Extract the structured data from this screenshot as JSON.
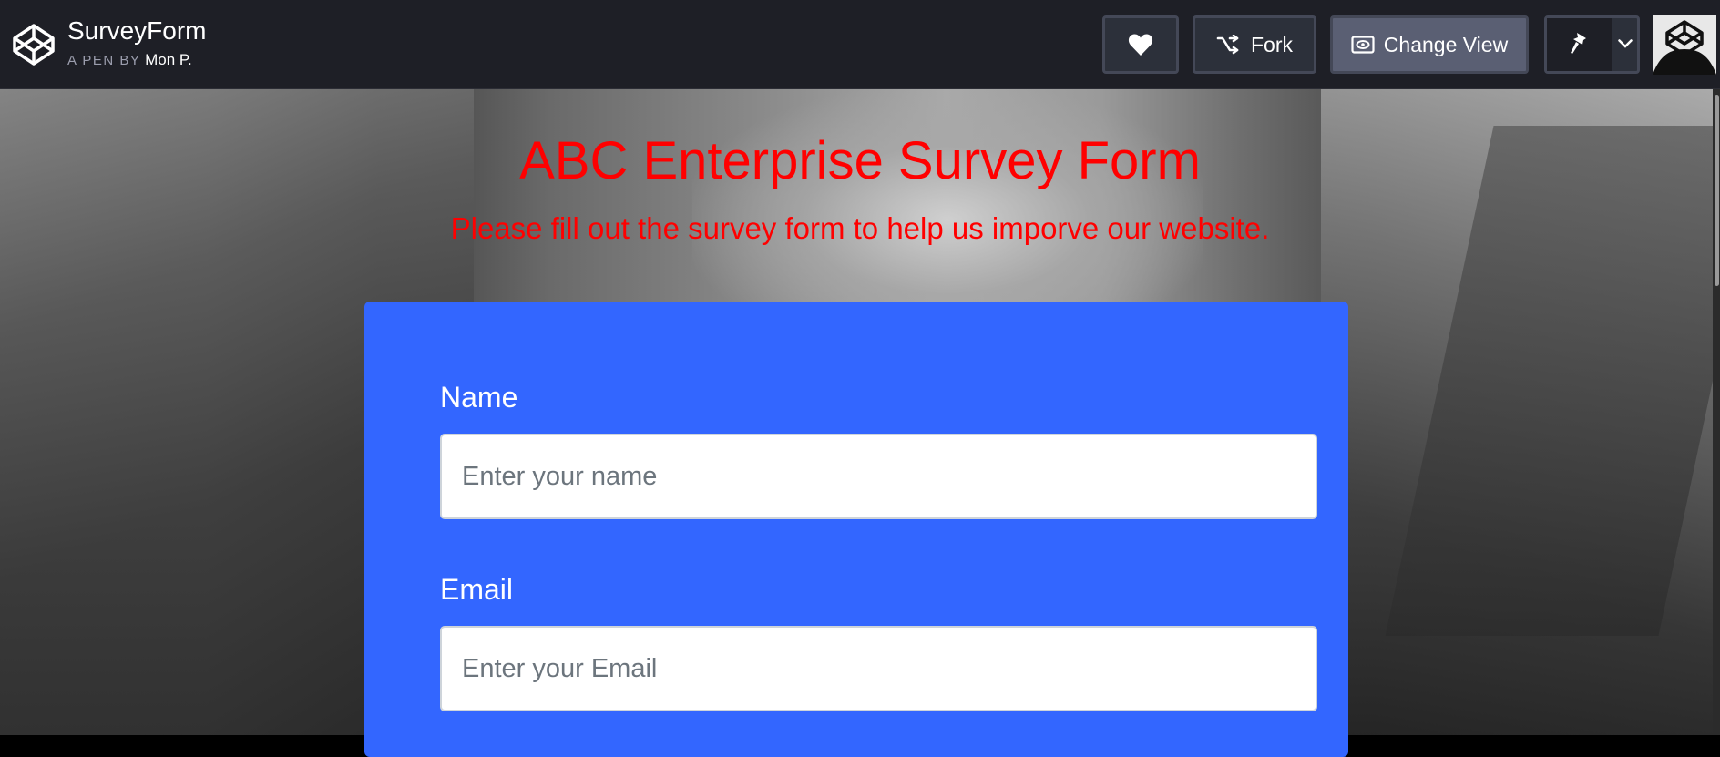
{
  "header": {
    "pen_title": "SurveyForm",
    "byline_prefix": "A PEN BY",
    "author": "Mon P.",
    "fork_label": "Fork",
    "change_view_label": "Change View"
  },
  "survey": {
    "title": "ABC Enterprise Survey Form",
    "description": "Please fill out the survey form to help us imporve our website.",
    "name_label": "Name",
    "name_placeholder": "Enter your name",
    "email_label": "Email",
    "email_placeholder": "Enter your Email"
  },
  "colors": {
    "topbar": "#1e1f26",
    "heading": "#ff0000",
    "form_background": "#3366ff",
    "button_active": "#5a5f73"
  },
  "icons": [
    "codepen-logo-icon",
    "heart-icon",
    "fork-icon",
    "eye-icon",
    "pin-icon",
    "chevron-down-icon",
    "avatar-icon"
  ]
}
